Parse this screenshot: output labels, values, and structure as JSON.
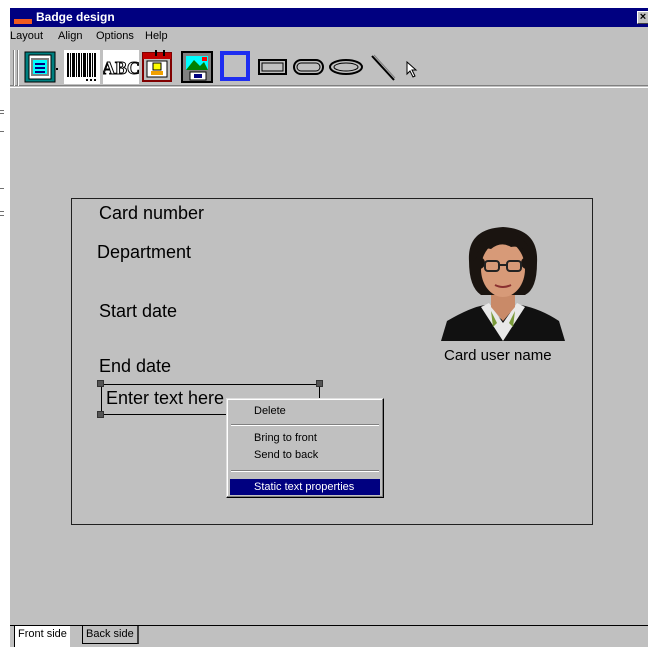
{
  "window": {
    "title": "Badge design",
    "close_glyph": "×"
  },
  "menu": [
    "Layout",
    "Align",
    "Options",
    "Help"
  ],
  "toolbar": {
    "icons": [
      "layout-icon",
      "barcode-icon",
      "abc-text-icon",
      "date-icon",
      "picture-icon",
      "square-tool-icon",
      "rectangle-tool-icon",
      "rounded-rect-tool-icon",
      "ellipse-tool-icon",
      "line-tool-icon",
      "pointer-tool-icon"
    ],
    "abc_label": "ABC"
  },
  "badge": {
    "fields": {
      "card_number": "Card number",
      "department": "Department",
      "start_date": "Start date",
      "end_date": "End date"
    },
    "card_user_name": "Card user name",
    "selected_text": "Enter text here"
  },
  "context_menu": {
    "delete": "Delete",
    "bring_to_front": "Bring to front",
    "send_to_back": "Send to back",
    "static_text_properties": "Static text properties"
  },
  "tabs": {
    "front": "Front side",
    "back": "Back side"
  },
  "colors": {
    "titlebar": "#000080",
    "face": "#c0c0c0",
    "highlight": "#000080",
    "tool_square": "#1e2df0"
  }
}
